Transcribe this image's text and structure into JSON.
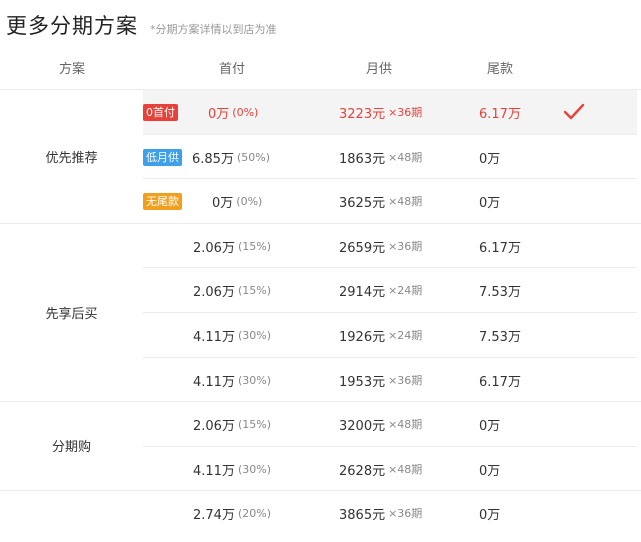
{
  "header": {
    "title": "更多分期方案",
    "note": "*分期方案详情以到店为准"
  },
  "columns": {
    "plan": "方案",
    "down": "首付",
    "monthly": "月供",
    "final": "尾款"
  },
  "groups": [
    {
      "name": "优先推荐",
      "rows": [
        {
          "tag": "0首付",
          "tag_color": "#e6423a",
          "down": "0万",
          "down_pct": "(0%)",
          "monthly": "3223元",
          "term": "×36期",
          "final": "6.17万",
          "selected": true
        },
        {
          "tag": "低月供",
          "tag_color": "#3f9fe8",
          "down": "6.85万",
          "down_pct": "(50%)",
          "monthly": "1863元",
          "term": "×48期",
          "final": "0万"
        },
        {
          "tag": "无尾款",
          "tag_color": "#f0a01e",
          "down": "0万",
          "down_pct": "(0%)",
          "monthly": "3625元",
          "term": "×48期",
          "final": "0万"
        }
      ]
    },
    {
      "name": "先享后买",
      "rows": [
        {
          "down": "2.06万",
          "down_pct": "(15%)",
          "monthly": "2659元",
          "term": "×36期",
          "final": "6.17万"
        },
        {
          "down": "2.06万",
          "down_pct": "(15%)",
          "monthly": "2914元",
          "term": "×24期",
          "final": "7.53万"
        },
        {
          "down": "4.11万",
          "down_pct": "(30%)",
          "monthly": "1926元",
          "term": "×24期",
          "final": "7.53万"
        },
        {
          "down": "4.11万",
          "down_pct": "(30%)",
          "monthly": "1953元",
          "term": "×36期",
          "final": "6.17万"
        }
      ]
    },
    {
      "name": "分期购",
      "rows": [
        {
          "down": "2.06万",
          "down_pct": "(15%)",
          "monthly": "3200元",
          "term": "×48期",
          "final": "0万"
        },
        {
          "down": "4.11万",
          "down_pct": "(30%)",
          "monthly": "2628元",
          "term": "×48期",
          "final": "0万"
        }
      ]
    },
    {
      "name": "",
      "rows": [
        {
          "down": "2.74万",
          "down_pct": "(20%)",
          "monthly": "3865元",
          "term": "×36期",
          "final": "0万"
        }
      ]
    }
  ],
  "selected_mark": {
    "icon": "check-icon",
    "color": "#e6423a"
  }
}
